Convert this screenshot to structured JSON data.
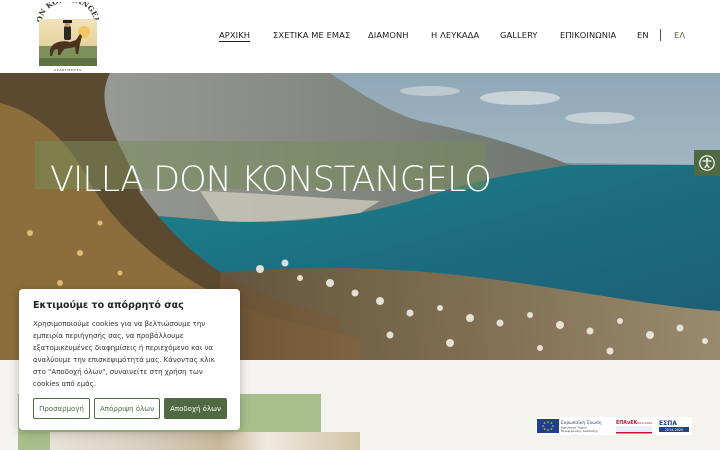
{
  "brand": {
    "name": "DON KONSTANGELO",
    "subtitle": "APARTMENTS"
  },
  "nav": {
    "items": [
      {
        "label": "ΑΡΧΙΚΗ",
        "active": true
      },
      {
        "label": "ΣΧΕΤΙΚΑ ΜΕ ΕΜΑΣ",
        "active": false
      },
      {
        "label": "ΔΙΑΜΟΝΗ",
        "active": false
      },
      {
        "label": "Η ΛΕΥΚΑΔΑ",
        "active": false
      },
      {
        "label": "GALLERY",
        "active": false
      },
      {
        "label": "ΕΠΙΚΟΙΝΩΝΙΑ",
        "active": false
      }
    ],
    "languages": [
      "EN",
      "ΕΛ"
    ],
    "active_language": "ΕΛ"
  },
  "hero": {
    "title": "VILLA DON KONSTANGELO"
  },
  "accessibility": {
    "icon": "accessibility-icon"
  },
  "cookie": {
    "title": "Εκτιμούμε το απόρρητό σας",
    "text": "Χρησιμοποιούμε cookies για να βελτιώσουμε την εμπειρία περιήγησής σας, να προβάλλουμε εξατομικευμένες διαφημίσεις ή περιεχόμενο και να αναλύουμε την επισκεψιμότητά μας. Κάνοντας κλικ στο \"Αποδοχή όλων\", συναινείτε στη χρήση των cookies από εμάς.",
    "buttons": {
      "customize": "Προσαρμογή",
      "reject": "Απόρριψη όλων",
      "accept": "Αποδοχή όλων"
    }
  },
  "espa": {
    "eu_label": "Ευρωπαϊκή Ένωση",
    "eu_sub1": "Ευρωπαϊκό Ταμείο",
    "eu_sub2": "Περιφερειακής Ανάπτυξης",
    "epanek": "ΕΠΑνΕΚ",
    "epanek_years": "2014-2020",
    "espa_label": "ΕΣΠΑ",
    "espa_years": "2014-2020"
  },
  "colors": {
    "accent": "#4f6a42",
    "panel_green": "#a8bf8c",
    "page_bg": "#f5f3ee"
  }
}
